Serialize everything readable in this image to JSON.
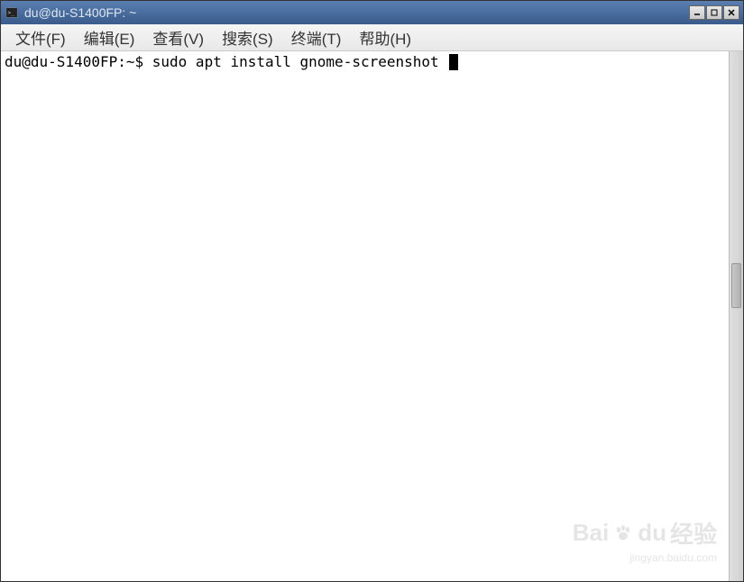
{
  "titlebar": {
    "title": "du@du-S1400FP: ~"
  },
  "menubar": {
    "items": [
      {
        "label": "文件(F)"
      },
      {
        "label": "编辑(E)"
      },
      {
        "label": "查看(V)"
      },
      {
        "label": "搜索(S)"
      },
      {
        "label": "终端(T)"
      },
      {
        "label": "帮助(H)"
      }
    ]
  },
  "terminal": {
    "prompt": "du@du-S1400FP:~$ ",
    "command": "sudo apt install gnome-screenshot "
  },
  "watermark": {
    "brand_left": "Bai",
    "brand_right": "du",
    "brand_suffix": "经验",
    "url": "jingyan.baidu.com"
  }
}
